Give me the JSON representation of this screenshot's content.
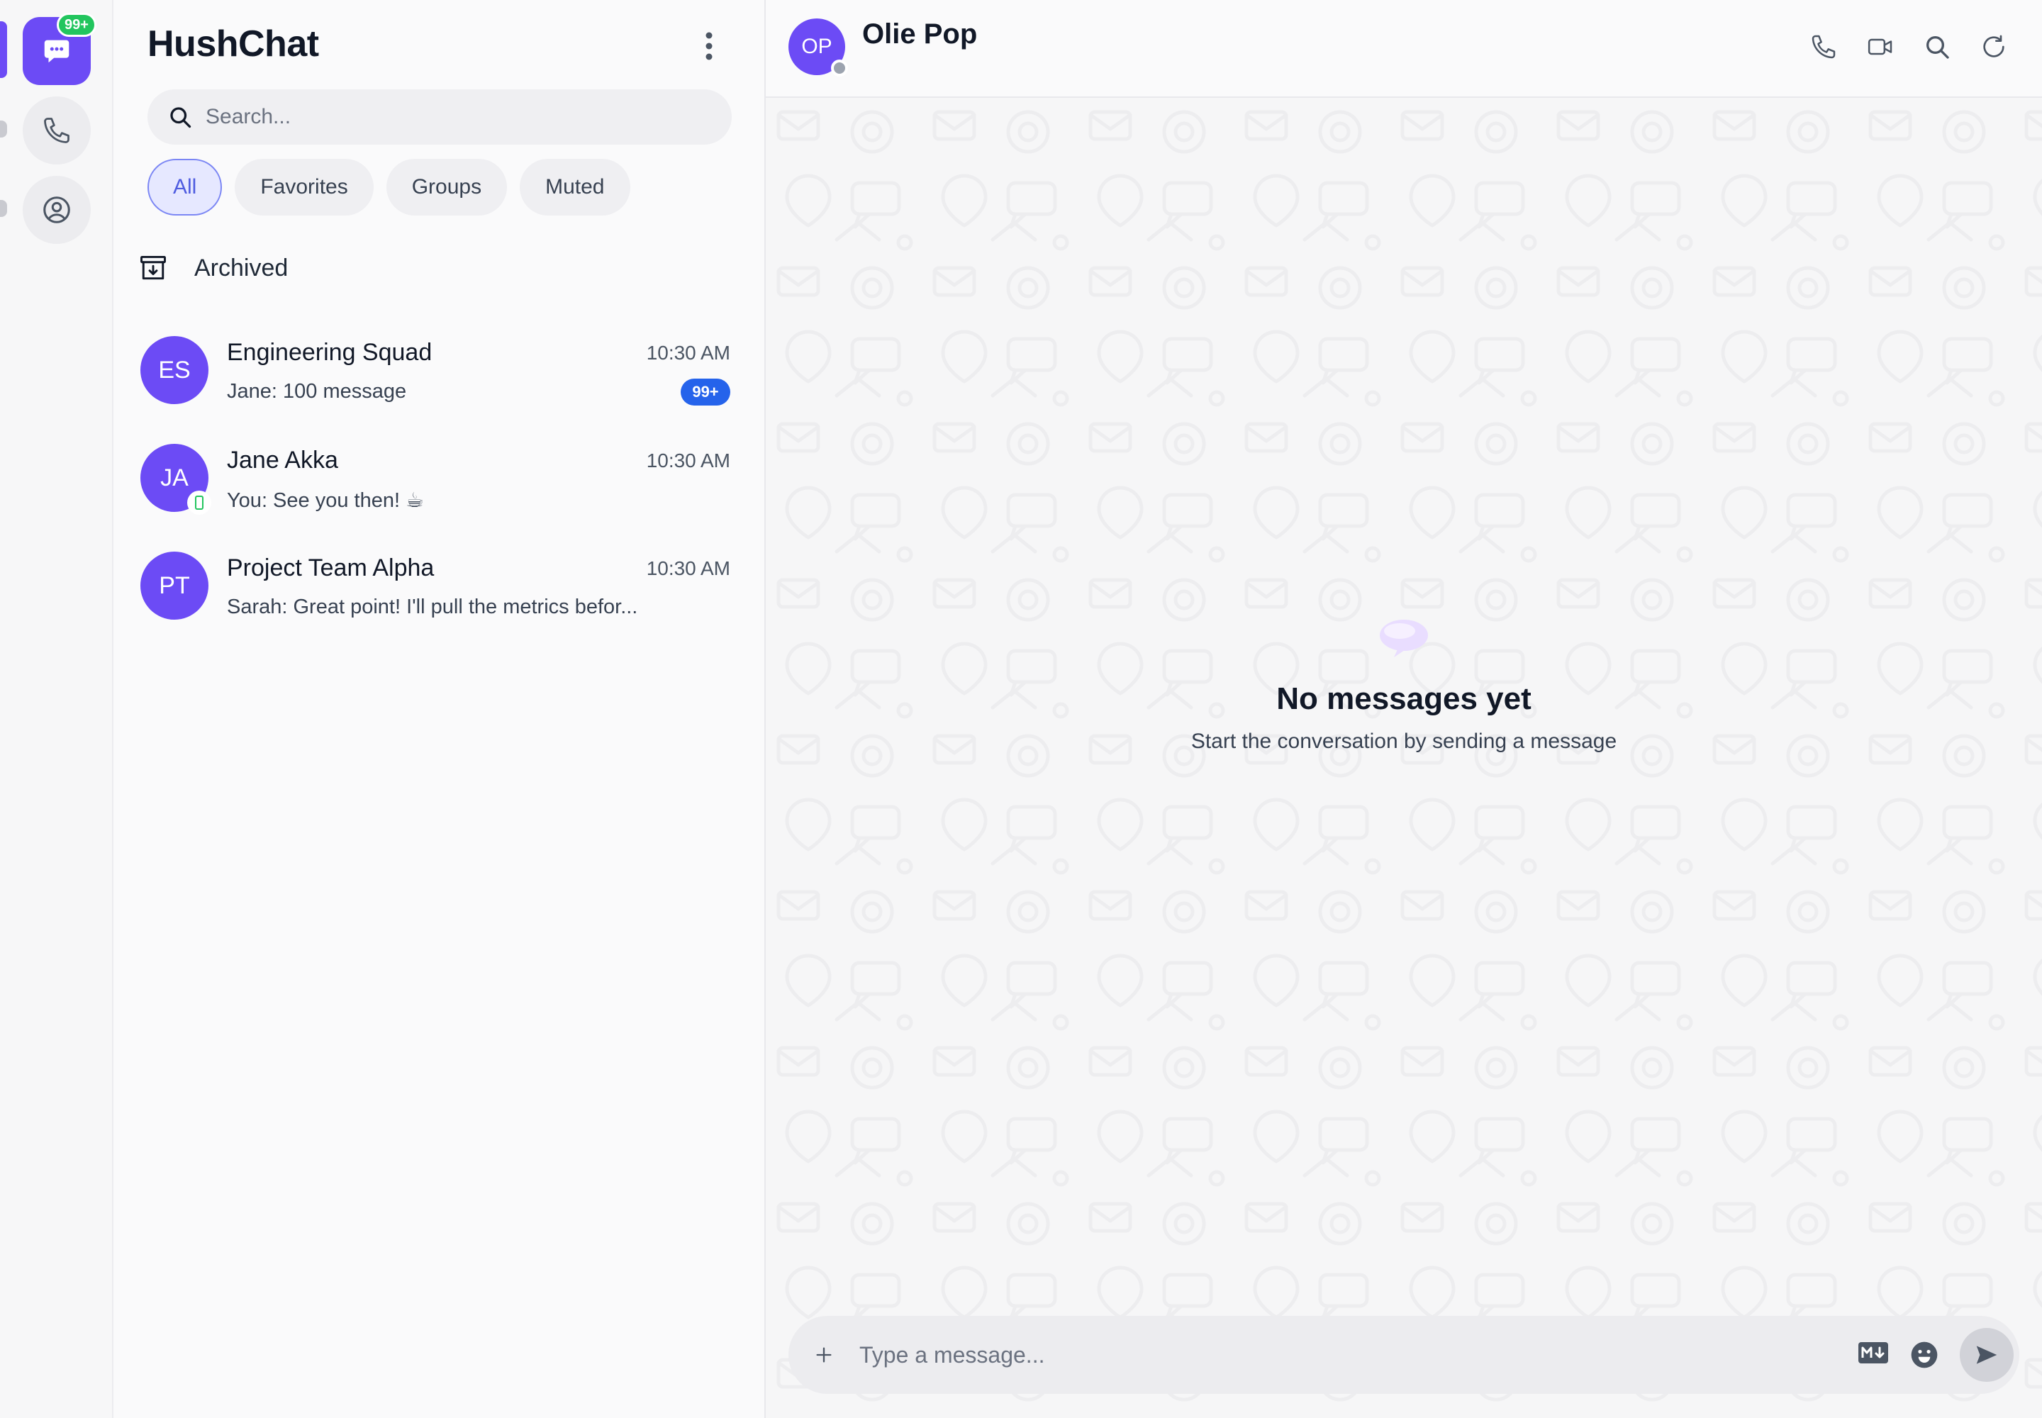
{
  "rail": {
    "chats_badge": "99+",
    "items": [
      {
        "name": "chats",
        "icon": "chat-bubble-icon",
        "active": true
      },
      {
        "name": "calls",
        "icon": "phone-icon",
        "active": false
      },
      {
        "name": "profile",
        "icon": "user-circle-icon",
        "active": false
      }
    ]
  },
  "sidebar": {
    "title": "HushChat",
    "search_placeholder": "Search...",
    "filters": [
      "All",
      "Favorites",
      "Groups",
      "Muted"
    ],
    "active_filter": "All",
    "archived_label": "Archived"
  },
  "conversations": [
    {
      "initials": "ES",
      "name": "Engineering Squad",
      "time": "10:30 AM",
      "preview": "Jane: 100 message",
      "unread": "99+"
    },
    {
      "initials": "JA",
      "name": "Jane Akka",
      "time": "10:30 AM",
      "preview": "You: See you then! ☕",
      "online": true
    },
    {
      "initials": "PT",
      "name": "Project Team Alpha",
      "time": "10:30 AM",
      "preview": "Sarah: Great point! I'll pull the metrics befor..."
    }
  ],
  "chat": {
    "contact_initials": "OP",
    "contact_name": "Olie Pop",
    "actions": [
      "phone-icon",
      "video-icon",
      "search-icon",
      "refresh-icon"
    ],
    "empty_title": "No messages yet",
    "empty_subtitle": "Start the conversation by sending a message",
    "composer_placeholder": "Type a message..."
  },
  "colors": {
    "accent": "#6c4bf5",
    "unread_badge": "#2563eb",
    "rail_badge": "#22c55e",
    "online": "#22c55e"
  }
}
